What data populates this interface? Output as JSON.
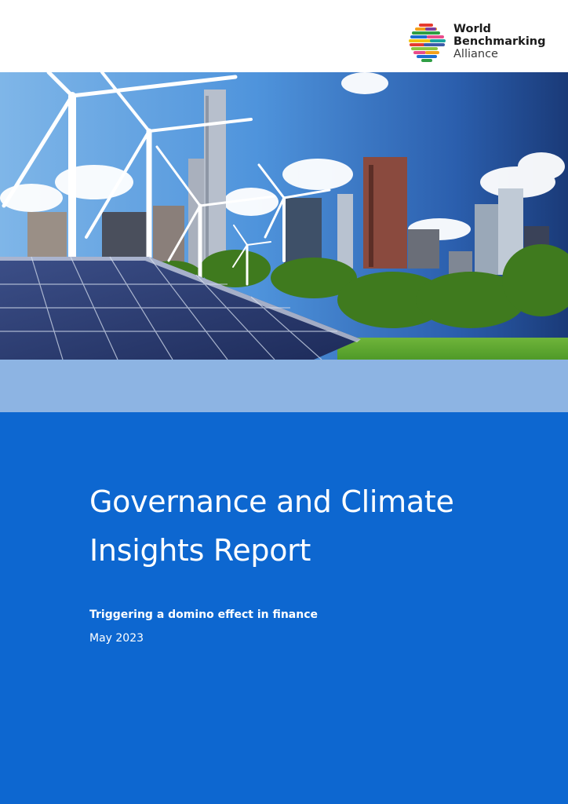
{
  "logo": {
    "line1": "World",
    "line2": "Benchmarking",
    "line3": "Alliance"
  },
  "cover_image": {
    "icon": "wind-turbines-solar-panels-city-skyline"
  },
  "report": {
    "title_line1": "Governance and Climate",
    "title_line2": "Insights Report",
    "subtitle": "Triggering a domino effect in finance",
    "date": "May 2023"
  },
  "colors": {
    "panel_blue": "#0d67d0",
    "band_light_blue": "#8db4e3"
  }
}
